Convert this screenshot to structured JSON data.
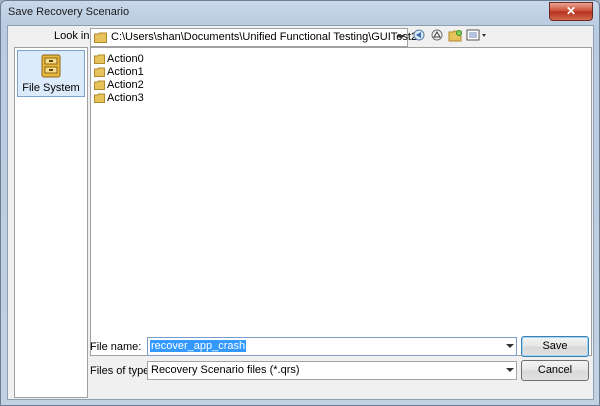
{
  "window": {
    "title": "Save Recovery Scenario",
    "close_label": "✕"
  },
  "toolbar": {
    "look_in_label": "Look in",
    "look_in_path": "C:\\Users\\shan\\Documents\\Unified Functional Testing\\GUITest2",
    "icons": [
      "back-icon",
      "up-folder-icon",
      "new-folder-icon",
      "view-menu-icon"
    ]
  },
  "places": [
    {
      "label": "File System",
      "icon": "file-system-icon"
    }
  ],
  "files": [
    {
      "name": "Action0",
      "icon": "folder-icon"
    },
    {
      "name": "Action1",
      "icon": "folder-icon"
    },
    {
      "name": "Action2",
      "icon": "folder-icon"
    },
    {
      "name": "Action3",
      "icon": "folder-icon"
    }
  ],
  "form": {
    "file_name_label": "File name:",
    "file_name_value": "recover_app_crash",
    "files_of_type_label": "Files of type:",
    "files_of_type_value": "Recovery Scenario files (*.qrs)"
  },
  "buttons": {
    "save": "Save",
    "cancel": "Cancel"
  },
  "colors": {
    "folder": "#e8c25a",
    "selection": "#3399ff",
    "close_button": "#c8492f"
  }
}
